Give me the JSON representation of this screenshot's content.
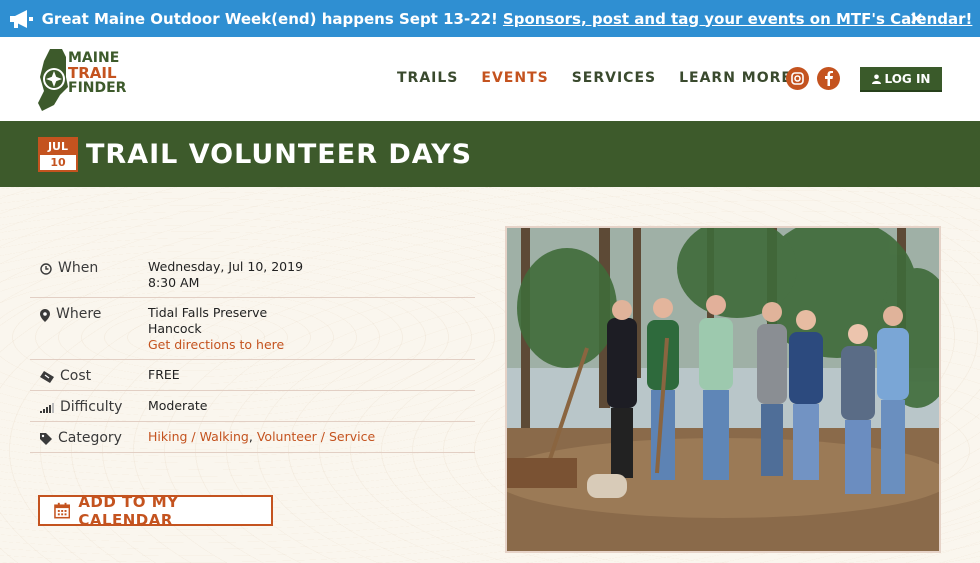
{
  "announcement": {
    "text": "Great Maine Outdoor Week(end) happens Sept 13-22!",
    "link": "Sponsors, post and tag your events on MTF's Calendar!",
    "close": "×"
  },
  "logo": {
    "line1": "MAINE",
    "line2": "TRAIL",
    "line3": "FINDER"
  },
  "nav": {
    "items": [
      {
        "label": "TRAILS"
      },
      {
        "label": "EVENTS"
      },
      {
        "label": "SERVICES"
      },
      {
        "label": "LEARN MORE"
      }
    ],
    "login": "LOG IN"
  },
  "event": {
    "month": "JUL",
    "day": "10",
    "title": "TRAIL VOLUNTEER DAYS",
    "when_label": "When",
    "when_date": "Wednesday, Jul 10, 2019",
    "when_time": "8:30 AM",
    "where_label": "Where",
    "where_place": "Tidal Falls Preserve",
    "where_town": "Hancock",
    "where_link": "Get directions to here",
    "cost_label": "Cost",
    "cost": "FREE",
    "difficulty_label": "Difficulty",
    "difficulty": "Moderate",
    "category_label": "Category",
    "categories": [
      "Hiking / Walking",
      "Volunteer / Service"
    ],
    "category_sep": ","
  },
  "calendar_button": "ADD TO MY CALENDAR",
  "colors": {
    "accent": "#c4531f",
    "green": "#3d5a2b",
    "banner": "#2f8fd2"
  }
}
